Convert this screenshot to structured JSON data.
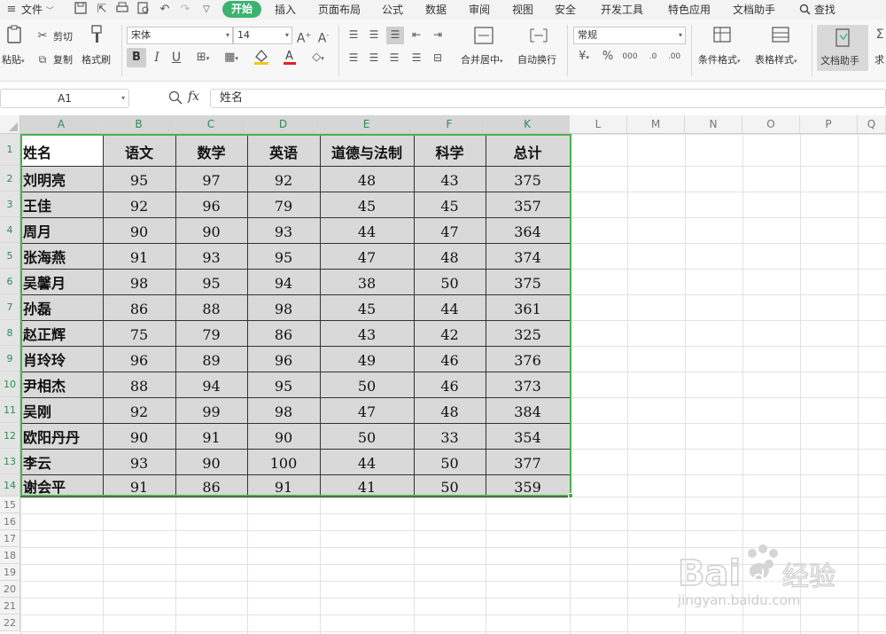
{
  "menubar": {
    "file_label": "文件",
    "tabs": [
      "开始",
      "插入",
      "页面布局",
      "公式",
      "数据",
      "审阅",
      "视图",
      "安全",
      "开发工具",
      "特色应用",
      "文档助手"
    ],
    "active_tab": "开始",
    "search_label": "查找"
  },
  "ribbon": {
    "paste_label": "粘贴",
    "cut_label": "剪切",
    "copy_label": "复制",
    "format_painter_label": "格式刷",
    "font_name": "宋体",
    "font_size": "14",
    "merge_center_label": "合并居中",
    "wrap_text_label": "自动换行",
    "number_format": "常规",
    "conditional_format_label": "条件格式",
    "table_style_label": "表格样式",
    "doc_helper_label": "文档助手",
    "sum_label": "求"
  },
  "formula_bar": {
    "cell_ref": "A1",
    "fx_label": "fx",
    "content": "姓名"
  },
  "sheet": {
    "column_headers": [
      "A",
      "B",
      "C",
      "D",
      "E",
      "F",
      "K",
      "L",
      "M",
      "N",
      "O",
      "P",
      "Q"
    ],
    "row_numbers": [
      "1",
      "2",
      "3",
      "4",
      "5",
      "6",
      "7",
      "8",
      "9",
      "10",
      "11",
      "12",
      "13",
      "14",
      "15",
      "16",
      "17",
      "18",
      "19",
      "20",
      "21",
      "22"
    ],
    "table_headers": [
      "姓名",
      "语文",
      "数学",
      "英语",
      "道德与法制",
      "科学",
      "总计"
    ],
    "rows": [
      [
        "刘明亮",
        "95",
        "97",
        "92",
        "48",
        "43",
        "375"
      ],
      [
        "王佳",
        "92",
        "96",
        "79",
        "45",
        "45",
        "357"
      ],
      [
        "周月",
        "90",
        "90",
        "93",
        "44",
        "47",
        "364"
      ],
      [
        "张海燕",
        "91",
        "93",
        "95",
        "47",
        "48",
        "374"
      ],
      [
        "吴馨月",
        "98",
        "95",
        "94",
        "38",
        "50",
        "375"
      ],
      [
        "孙磊",
        "86",
        "88",
        "98",
        "45",
        "44",
        "361"
      ],
      [
        "赵正辉",
        "75",
        "79",
        "86",
        "43",
        "42",
        "325"
      ],
      [
        "肖玲玲",
        "96",
        "89",
        "96",
        "49",
        "46",
        "376"
      ],
      [
        "尹相杰",
        "88",
        "94",
        "95",
        "50",
        "46",
        "373"
      ],
      [
        "吴刚",
        "92",
        "99",
        "98",
        "47",
        "48",
        "384"
      ],
      [
        "欧阳丹丹",
        "90",
        "91",
        "90",
        "50",
        "33",
        "354"
      ],
      [
        "李云",
        "93",
        "90",
        "100",
        "44",
        "50",
        "377"
      ],
      [
        "谢会平",
        "91",
        "86",
        "91",
        "41",
        "50",
        "359"
      ]
    ]
  },
  "watermark": {
    "brand": "Bai",
    "brand2": "du",
    "cn": "经验",
    "url": "jingyan.baidu.com"
  },
  "colors": {
    "accent": "#3cb371",
    "selection": "#4caf50",
    "shade": "#d9d9d9"
  }
}
